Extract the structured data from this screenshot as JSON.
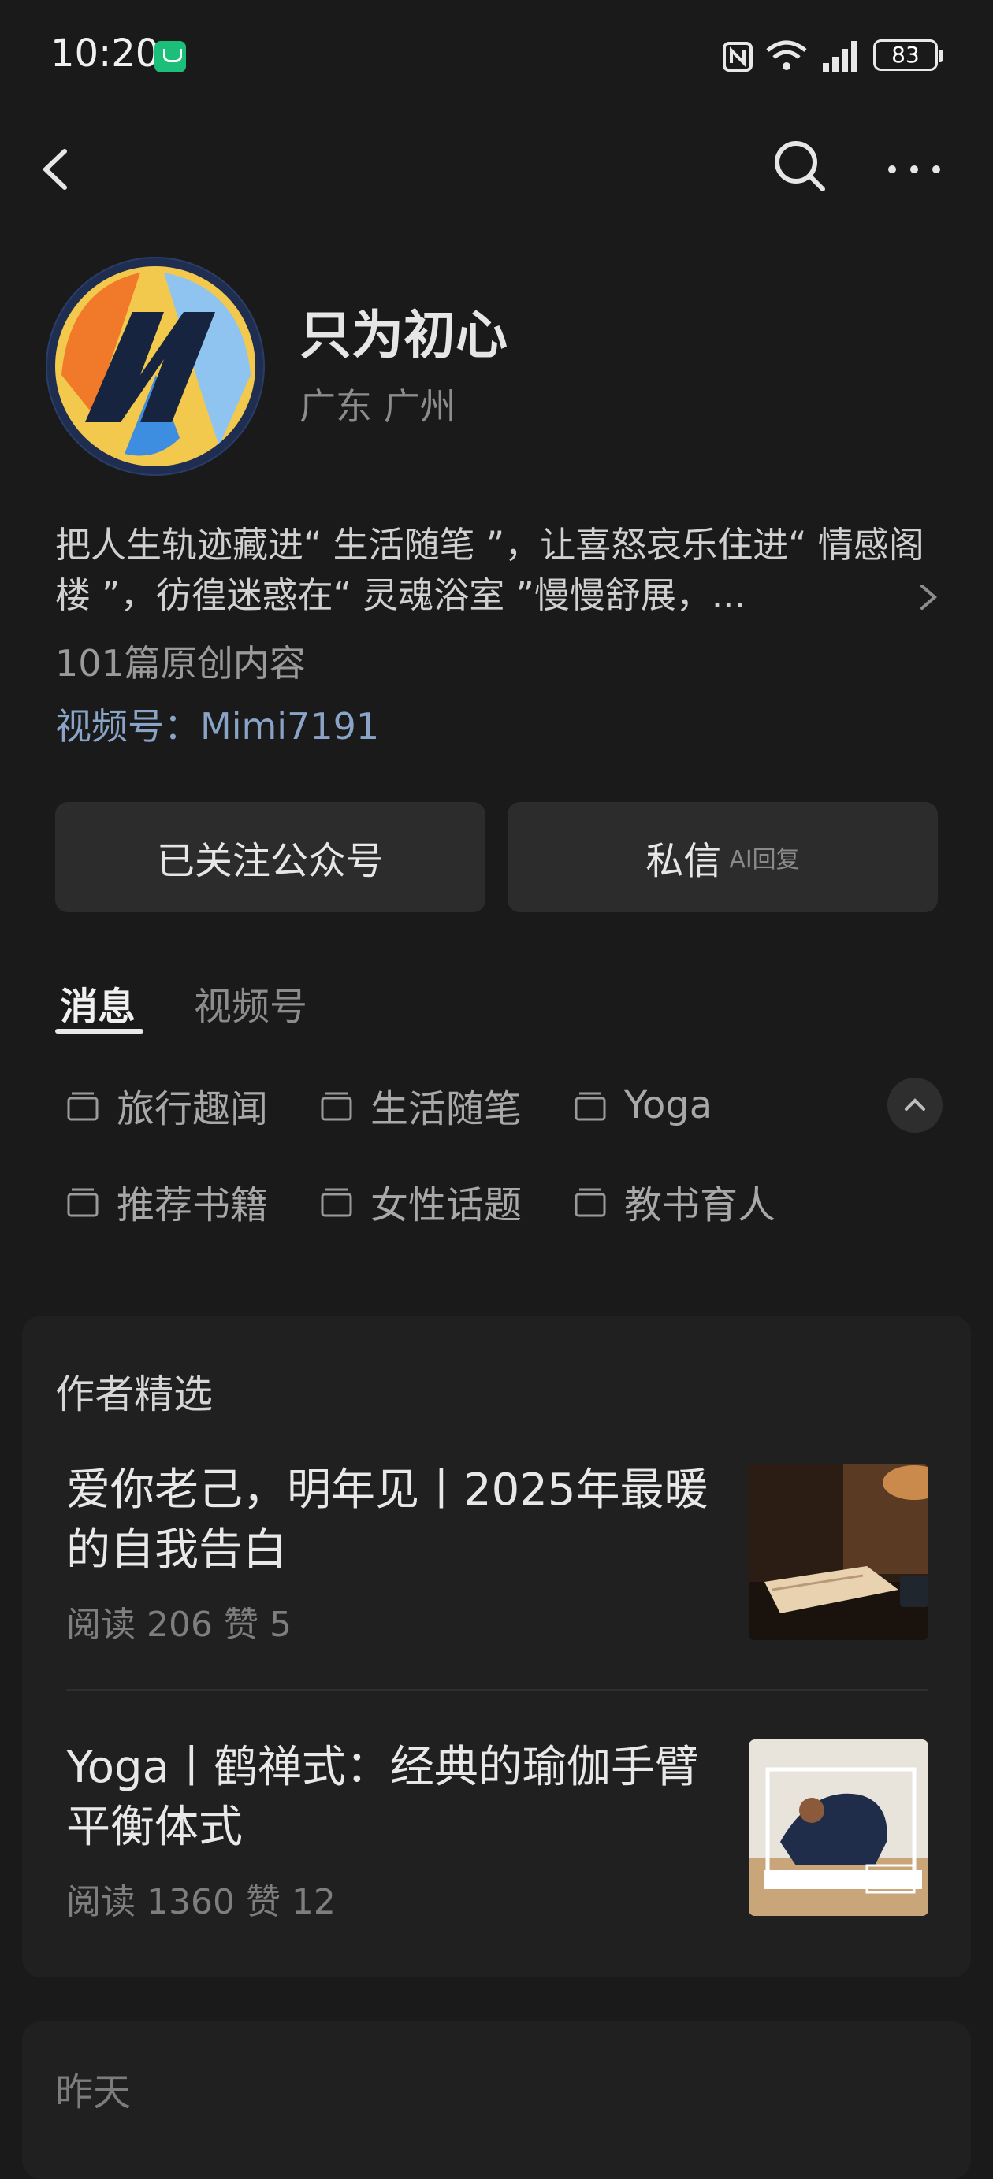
{
  "status_bar": {
    "time": "10:20",
    "battery": "83"
  },
  "profile": {
    "name": "只为初心",
    "location": "广东 广州",
    "bio": "把人生轨迹藏进“ 生活随笔 ”，让喜怒哀乐住进“ 情感阁楼 ”，彷徨迷惑在“ 灵魂浴室 ”慢慢舒展，...",
    "original_count": "101篇原创内容",
    "video_account": "视频号：Mimi7191"
  },
  "actions": {
    "follow_label": "已关注公众号",
    "message_label": "私信",
    "message_sub": "AI回复"
  },
  "tabs": [
    {
      "label": "消息"
    },
    {
      "label": "视频号"
    }
  ],
  "collections": [
    {
      "label": "旅行趣闻"
    },
    {
      "label": "生活随笔"
    },
    {
      "label": "Yoga"
    },
    {
      "label": "推荐书籍"
    },
    {
      "label": "女性话题"
    },
    {
      "label": "教书育人"
    }
  ],
  "author_picks": {
    "title": "作者精选",
    "articles": [
      {
        "title": "爱你老己，明年见丨2025年最暖的自我告白",
        "meta": "阅读 206  赞 5"
      },
      {
        "title": "Yoga丨鹤禅式：经典的瑜伽手臂平衡体式",
        "meta": "阅读 1360  赞 12"
      }
    ]
  },
  "yesterday": {
    "label": "昨天"
  }
}
